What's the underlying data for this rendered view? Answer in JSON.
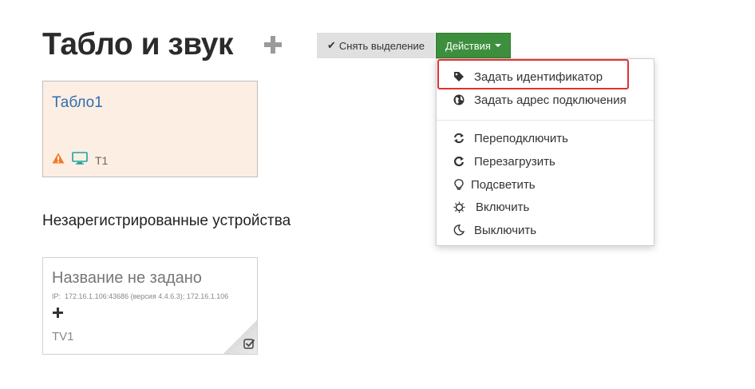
{
  "page": {
    "title": "Табло и звук"
  },
  "toolbar": {
    "deselect_label": "Снять выделение",
    "actions_label": "Действия"
  },
  "actions_menu": {
    "items": [
      {
        "label": "Задать идентификатор",
        "icon": "tag-icon"
      },
      {
        "label": "Задать адрес подключения",
        "icon": "globe-icon"
      },
      {
        "label": "Переподключить",
        "icon": "refresh-icon"
      },
      {
        "label": "Перезагрузить",
        "icon": "reload-icon"
      },
      {
        "label": "Подсветить",
        "icon": "lightbulb-icon"
      },
      {
        "label": "Включить",
        "icon": "sun-icon"
      },
      {
        "label": "Выключить",
        "icon": "moon-icon"
      }
    ]
  },
  "devices": [
    {
      "name": "Табло1",
      "code": "T1",
      "status_icons": [
        "warning-icon",
        "monitor-icon"
      ]
    }
  ],
  "unregistered": {
    "heading": "Незарегистрированные устройства",
    "items": [
      {
        "name": "Название не задано",
        "ip_label": "IP:",
        "ip_text": "172.16.1.106:43686 (версия 4.4.6.3); 172.16.1.106",
        "code": "TV1"
      }
    ]
  },
  "colors": {
    "accent_green": "#3d8f3d",
    "link_blue": "#2f6fae",
    "card_bg": "#fdeee3",
    "warning_orange": "#f07c28",
    "monitor_teal": "#1aa59a",
    "highlight_red": "#e03131"
  }
}
